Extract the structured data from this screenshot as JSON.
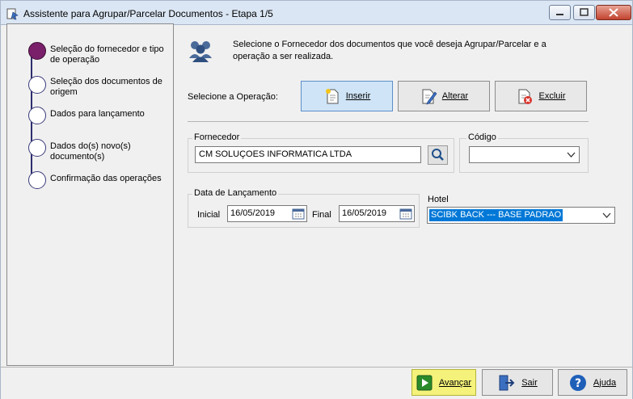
{
  "window": {
    "title": "Assistente para Agrupar/Parcelar Documentos - Etapa 1/5"
  },
  "steps": [
    {
      "label": "Seleção do fornecedor e tipo de operação",
      "active": true
    },
    {
      "label": "Seleção dos documentos de origem",
      "active": false
    },
    {
      "label": "Dados para lançamento",
      "active": false
    },
    {
      "label": "Dados do(s) novo(s) documento(s)",
      "active": false
    },
    {
      "label": "Confirmação das operações",
      "active": false
    }
  ],
  "header": {
    "text": "Selecione o Fornecedor dos documentos que você deseja Agrupar/Parcelar e a operação a ser realizada."
  },
  "operation": {
    "label": "Selecione a Operação:",
    "buttons": {
      "inserir": "Inserir",
      "alterar": "Alterar",
      "excluir": "Excluir"
    },
    "selected": "Inserir"
  },
  "fornecedor": {
    "label": "Fornecedor",
    "value": "CM SOLUÇOES INFORMATICA LTDA"
  },
  "codigo": {
    "label": "Código",
    "value": ""
  },
  "data_lancamento": {
    "label": "Data de Lançamento",
    "inicial_label": "Inicial",
    "inicial_value": "16/05/2019",
    "final_label": "Final",
    "final_value": "16/05/2019"
  },
  "hotel": {
    "label": "Hotel",
    "value": "SCIBK BACK --- BASE PADRAO"
  },
  "footer": {
    "avancar": "Avançar",
    "sair": "Sair",
    "ajuda": "Ajuda"
  },
  "colors": {
    "accent": "#0078d7",
    "active_step": "#7a1f6a",
    "primary_button": "#f4f27a"
  }
}
